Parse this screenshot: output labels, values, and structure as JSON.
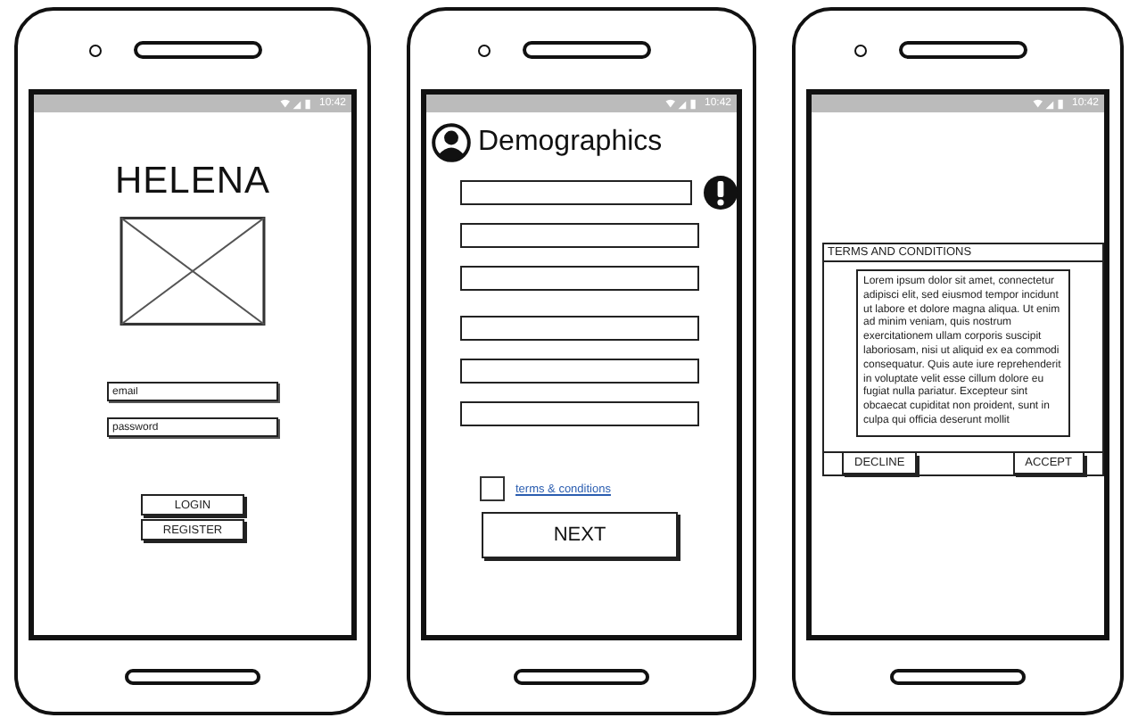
{
  "login_screen": {
    "status_time": "10:42",
    "title": "HELENA",
    "fields": [
      {
        "placeholder": "email"
      },
      {
        "placeholder": "password"
      }
    ],
    "buttons": [
      "LOGIN",
      "REGISTER"
    ]
  },
  "demographics_screen": {
    "status_time": "10:42",
    "title": "Demographics",
    "fields": [
      {
        "error": true
      },
      {
        "error": false
      },
      {
        "error": false
      },
      {
        "error": false
      },
      {
        "error": false
      },
      {
        "error": false
      }
    ],
    "terms": {
      "checked": false,
      "label": "terms & conditions"
    },
    "button": "NEXT"
  },
  "terms_screen": {
    "status_time": "10:42",
    "dialog": {
      "title": "TERMS AND CONDITIONS",
      "body": "Lorem ipsum dolor sit amet, connectetur adipisci elit, sed eiusmod tempor incidunt ut labore et dolore magna aliqua. Ut enim ad minim veniam, quis nostrum exercitationem ullam corporis suscipit laboriosam, nisi ut aliquid ex ea commodi consequatur. Quis aute iure reprehenderit in voluptate velit esse cillum dolore eu fugiat nulla pariatur. Excepteur sint obcaecat cupiditat non proident, sunt in culpa qui officia deserunt mollit",
      "buttons": [
        "DECLINE",
        "ACCEPT"
      ]
    }
  }
}
